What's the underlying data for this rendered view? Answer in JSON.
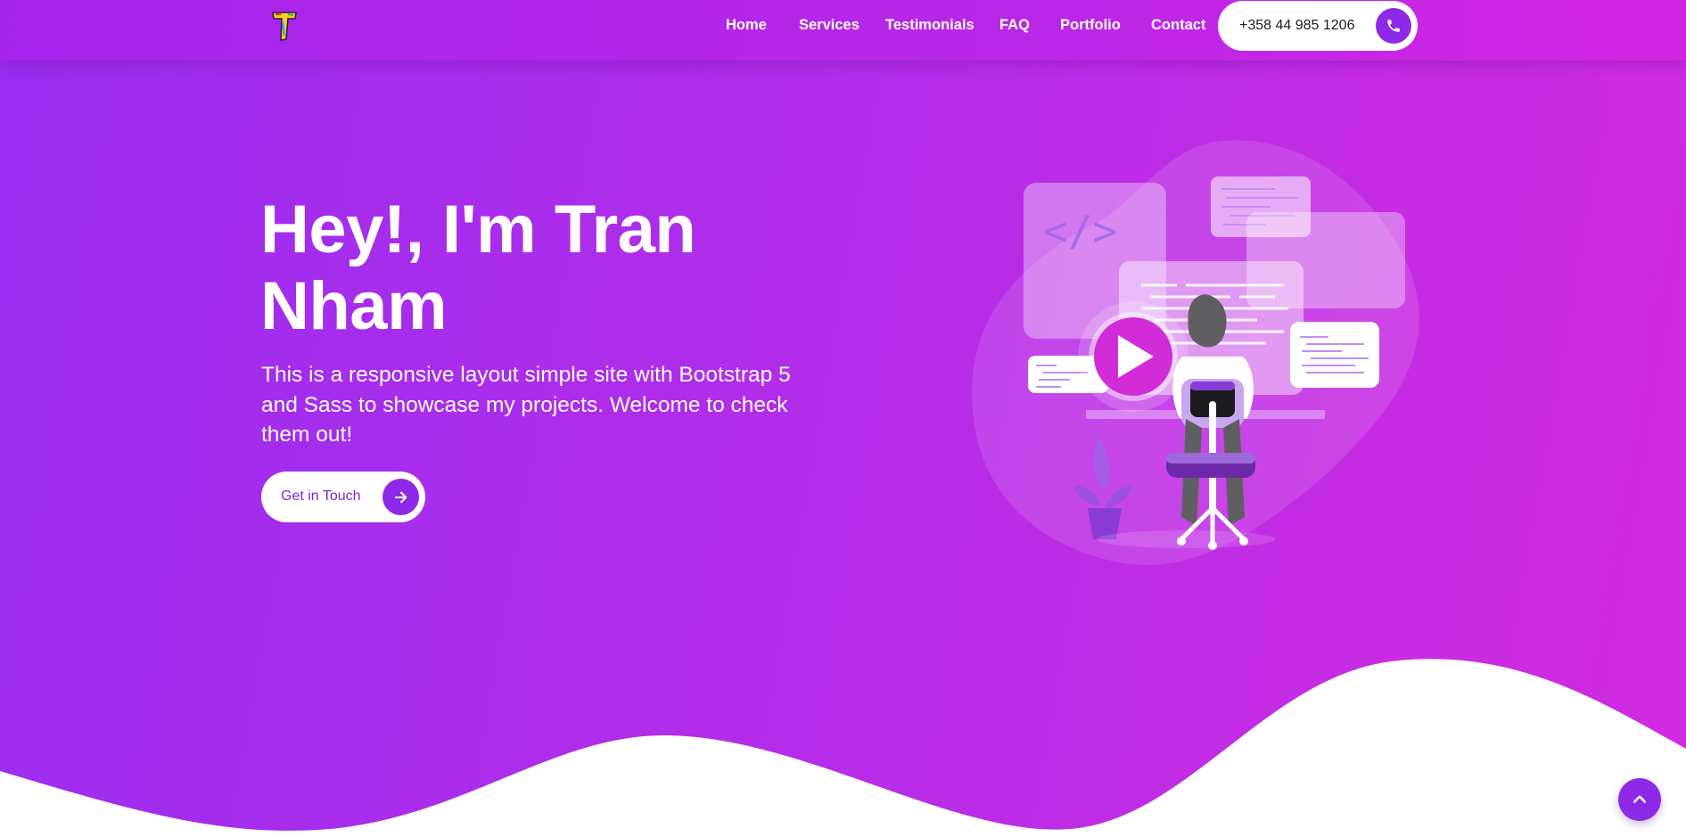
{
  "brand": {
    "logo_icon": "letter-t-logo-icon"
  },
  "nav": {
    "items": [
      {
        "label": "Home"
      },
      {
        "label": "Services"
      },
      {
        "label": "Testimonials"
      },
      {
        "label": "FAQ"
      },
      {
        "label": "Portfolio"
      },
      {
        "label": "Contact"
      }
    ],
    "phone": {
      "number": "+358 44 985 1206",
      "icon": "phone-icon"
    }
  },
  "hero": {
    "title_line1": "Hey!, I'm Tran",
    "title_line2": "Nham",
    "description": "This is a responsive layout simple site with Bootstrap 5 and Sass to showcase my projects. Welcome to check them out!",
    "cta_label": "Get in Touch",
    "cta_icon": "arrow-right-icon",
    "illustration": "developer-at-desk-illustration"
  },
  "scroll_top": {
    "icon": "chevron-up-icon"
  },
  "colors": {
    "gradient_start": "#9a2df0",
    "gradient_end": "#d22be0",
    "accent": "#8c2ae8",
    "cta_text": "#7b2ad6"
  }
}
